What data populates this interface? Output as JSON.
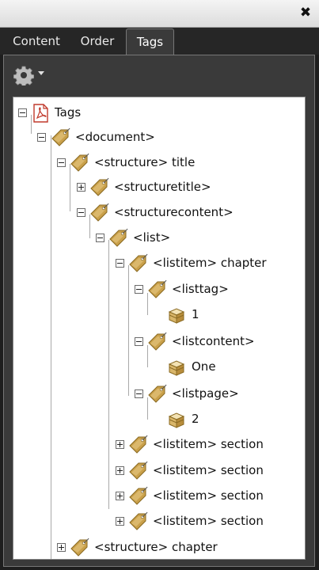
{
  "window": {
    "close_glyph": "✖"
  },
  "tabs": [
    {
      "label": "Content"
    },
    {
      "label": "Order"
    },
    {
      "label": "Tags"
    }
  ],
  "toolbar": {
    "options_icon": "gear-icon",
    "dropdown_icon": "caret-down-icon"
  },
  "tree": {
    "root": {
      "label": "Tags",
      "icon": "pdf-icon"
    },
    "document": {
      "label": "<document>"
    },
    "structure1": {
      "label": "<structure> title"
    },
    "structuretitle": {
      "label": "<structuretitle>"
    },
    "structurecontent": {
      "label": "<structurecontent>"
    },
    "list": {
      "label": "<list>"
    },
    "listitem_chapter": {
      "label": "<listitem> chapter"
    },
    "listtag": {
      "label": "<listtag>"
    },
    "listtag_text": {
      "label": "1"
    },
    "listcontent": {
      "label": "<listcontent>"
    },
    "listcontent_text": {
      "label": "One"
    },
    "listpage": {
      "label": "<listpage>"
    },
    "listpage_text": {
      "label": "2"
    },
    "section_items": [
      {
        "label": "<listitem> section"
      },
      {
        "label": "<listitem> section"
      },
      {
        "label": "<listitem> section"
      },
      {
        "label": "<listitem> section"
      }
    ],
    "structure2": {
      "label": "<structure> chapter"
    }
  },
  "colors": {
    "tag_icon": "#c9a04a",
    "panel_bg": "#3a3a3a",
    "tree_bg": "#ffffff"
  }
}
